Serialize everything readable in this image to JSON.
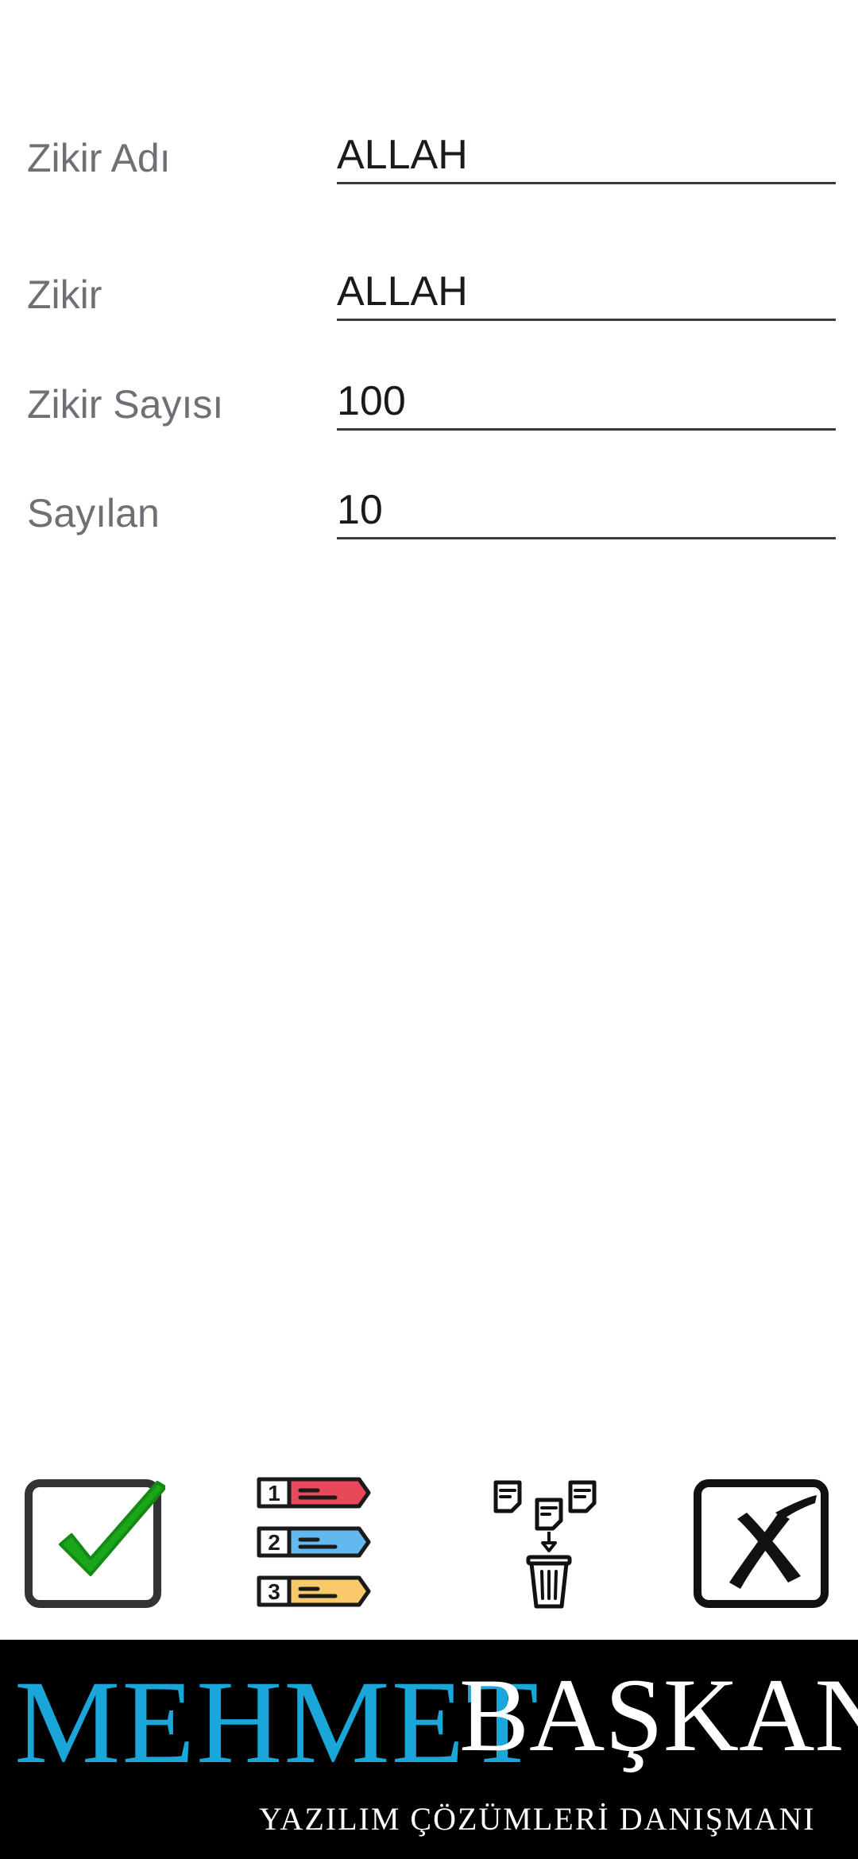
{
  "form": {
    "fields": [
      {
        "label": "Zikir Adı",
        "value": "ALLAH"
      },
      {
        "label": "Zikir",
        "value": "ALLAH"
      },
      {
        "label": "Zikir Sayısı",
        "value": "100"
      },
      {
        "label": "Sayılan",
        "value": "10"
      }
    ]
  },
  "toolbar": {
    "buttons": [
      {
        "icon": "check-icon",
        "accent": "#1aa51a"
      },
      {
        "icon": "numbered-list-icon",
        "colors": [
          "#e8485a",
          "#64b8f0",
          "#f7c96a"
        ],
        "numbers": [
          "1",
          "2",
          "3"
        ]
      },
      {
        "icon": "delete-documents-icon"
      },
      {
        "icon": "cancel-icon"
      }
    ]
  },
  "banner": {
    "name_first": "MEHMET",
    "name_last": "BAŞKAN",
    "subtitle": "YAZILIM ÇÖZÜMLERİ DANIŞMANI",
    "colors": {
      "background": "#000000",
      "first": "#1aa6d8",
      "last": "#ffffff"
    }
  }
}
